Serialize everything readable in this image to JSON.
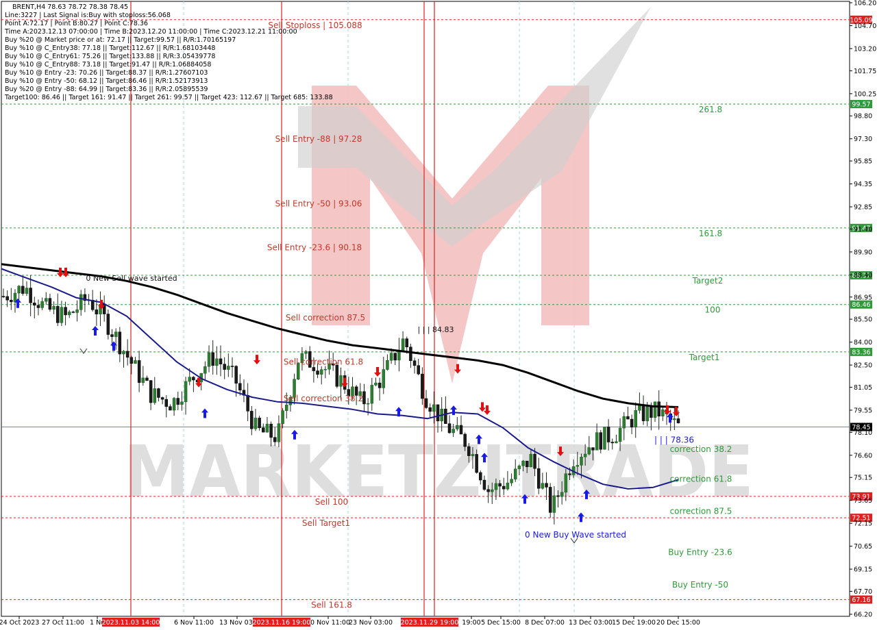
{
  "info_lines": [
    "BRENT,H4  78.63 78.72 78.38 78.45",
    "Line:3227  |  Last Signal is:Buy with stoploss:56.068",
    "Point A:72.17  |  Point B:80.27  |  Point C:78.36",
    "Time A:2023.12.13 07:00:00  |  Time B:2023.12.20 11:00:00  |  Time C:2023.12.21 11:00:00",
    "Buy %20 @ Market price or at: 72.17  ||  Target:99.57  ||  R/R:1.70165197",
    "Buy %10 @ C_Entry38: 77.18  ||  Target:112.67  ||  R/R:1.68103448",
    "Buy %10 @ C_Entry61: 75.26  ||  Target:133.88  ||  R/R:3.05439778",
    "Buy %10 @ C_Entry88: 73.18  ||  Target:91.47  ||  R/R:1.06884058",
    "Buy %10 @ Entry -23: 70.26  ||  Target:88.37  ||  R/R:1.27607103",
    "Buy %10 @ Entry -50: 68.12  ||  Target:86.46  ||  R/R:1.52173913",
    "Buy %20 @ Entry -88: 64.99  ||  Target:83.36  ||  R/R:2.05895539",
    "Target100: 86.46  ||  Target 161: 91.47  ||  Target 261: 99.57  ||  Target 423: 112.67  ||  Target 685: 133.88"
  ],
  "watermark": {
    "text": "MARKETZITRADE",
    "logo_color": "#e05555"
  },
  "chart_data": {
    "type": "line",
    "title": "BRENT,H4",
    "ylim": [
      66.2,
      106.2
    ],
    "y_ticks": [
      "106.20",
      "104.70",
      "103.20",
      "101.75",
      "100.25",
      "98.80",
      "97.30",
      "95.85",
      "94.35",
      "92.85",
      "91.40",
      "89.90",
      "88.40",
      "86.95",
      "85.50",
      "84.00",
      "82.50",
      "81.05",
      "79.55",
      "78.10",
      "76.60",
      "75.15",
      "73.65",
      "72.15",
      "70.65",
      "69.15",
      "67.70",
      "66.20"
    ],
    "x_ticks": [
      "24 Oct 2023",
      "27 Oct 11:00",
      "1 No",
      "6 Nov 11:00",
      "13 Nov 03:",
      "20 Nov 11:00",
      "23 Nov 03:00",
      "19:00",
      "5 Dec 15:00",
      "8 Dec 07:00",
      "13 Dec 03:00",
      "15 Dec 19:00",
      "20 Dec 15:00"
    ],
    "highlighted_times": [
      "2023.11.03 14:00",
      "2023.11.16 19:00",
      "2023.11.29 19:00"
    ],
    "vertical_lines_x_labels": [
      "2023.11.03 14:00",
      "2023.11.16 19:00",
      "2023.11.29 19:00"
    ],
    "current_price": 78.45,
    "levels": [
      {
        "name": "Sell Stoploss",
        "value": 105.09,
        "label": "Sell Stoploss | 105.088",
        "box": "105.09",
        "color": "#e02020",
        "text_color": "red",
        "label_side": "center"
      },
      {
        "name": "261.8",
        "value": 99.57,
        "label": "261.8",
        "box": "99.57",
        "color": "#2e9a3a",
        "text_color": "green",
        "label_side": "right"
      },
      {
        "name": "161.8",
        "value": 91.47,
        "label": "161.8",
        "box": "91.47",
        "color": "#2e9a3a",
        "text_color": "green",
        "label_side": "right"
      },
      {
        "name": "Target2",
        "value": 88.37,
        "label": "Target2",
        "box": "88.37",
        "color": "#2e9a3a",
        "text_color": "green",
        "label_side": "right"
      },
      {
        "name": "100",
        "value": 86.46,
        "label": "100",
        "box": "86.46",
        "color": "#2e9a3a",
        "text_color": "green",
        "label_side": "right"
      },
      {
        "name": "Target1",
        "value": 83.36,
        "label": "Target1",
        "box": "83.36",
        "color": "#2e9a3a",
        "text_color": "green",
        "label_side": "right"
      },
      {
        "name": "Sell 100",
        "value": 73.91,
        "label": "Sell 100",
        "box": "73.91",
        "color": "#e02020",
        "text_color": "red",
        "label_side": "center"
      },
      {
        "name": "Sell Target1",
        "value": 72.51,
        "label": "Sell Target1",
        "box": "72.51",
        "color": "#e02020",
        "text_color": "red",
        "label_side": "center"
      },
      {
        "name": "Sell 161.8",
        "value": 67.16,
        "label": "Sell 161.8",
        "box": "67.16",
        "color": "#e02020",
        "text_color": "red",
        "label_side": "center"
      }
    ],
    "text_labels": [
      {
        "text": "Sell Entry -88 | 97.28",
        "value": 97.28,
        "color": "red"
      },
      {
        "text": "Sell Entry -50 | 93.06",
        "value": 93.06,
        "color": "red"
      },
      {
        "text": "Sell Entry -23.6 | 90.18",
        "value": 90.18,
        "color": "red"
      },
      {
        "text": "Sell correction 87.5",
        "value": 85.6,
        "color": "red"
      },
      {
        "text": "Sell correction 61.8",
        "value": 82.7,
        "color": "red"
      },
      {
        "text": "Sell correction 38.2",
        "value": 80.3,
        "color": "red"
      },
      {
        "text": "correction 38.2",
        "value": 77.0,
        "color": "green"
      },
      {
        "text": "correction 61.8",
        "value": 75.05,
        "color": "green"
      },
      {
        "text": "correction 87.5",
        "value": 72.95,
        "color": "green"
      },
      {
        "text": "Buy Entry -23.6",
        "value": 70.26,
        "color": "green"
      },
      {
        "text": "Buy Entry -50",
        "value": 68.12,
        "color": "green"
      },
      {
        "text": "| | | 84.83",
        "value": 84.83,
        "color": "dark"
      },
      {
        "text": "| | | 78.36",
        "value": 77.6,
        "color": "blue"
      },
      {
        "text": "0 New Sell wave started",
        "value": 88.2,
        "color": "dark"
      },
      {
        "text": "0 New Buy Wave started",
        "value": 71.4,
        "color": "blue"
      }
    ],
    "series": [
      {
        "name": "MA200",
        "color": "#000000",
        "values": [
          89.1,
          88.9,
          88.7,
          88.5,
          88.3,
          88.0,
          87.6,
          87.1,
          86.5,
          85.9,
          85.4,
          84.9,
          84.5,
          84.1,
          83.8,
          83.6,
          83.4,
          83.2,
          83.0,
          82.8,
          82.5,
          82.0,
          81.4,
          80.8,
          80.3,
          80.0,
          79.8,
          79.75
        ]
      },
      {
        "name": "MA50",
        "color": "#1a1a8c",
        "values": [
          88.8,
          88.2,
          87.6,
          86.9,
          86.6,
          85.7,
          84.2,
          82.7,
          81.6,
          80.9,
          80.4,
          80.1,
          80.0,
          79.8,
          79.6,
          79.3,
          79.2,
          79.0,
          79.4,
          79.3,
          78.4,
          77.1,
          76.2,
          75.4,
          74.7,
          74.4,
          74.5,
          75.0
        ]
      },
      {
        "name": "Price",
        "color": "#222222",
        "values": [
          87.0,
          87.6,
          86.2,
          85.6,
          86.9,
          85.1,
          82.8,
          80.6,
          80.0,
          81.7,
          83.1,
          81.5,
          78.2,
          77.8,
          83.0,
          82.5,
          81.5,
          80.0,
          81.8,
          84.2,
          80.5,
          78.5,
          77.4,
          74.3,
          74.9,
          76.4,
          73.0,
          76.4,
          77.5,
          78.0,
          79.2,
          79.5,
          78.45
        ]
      }
    ]
  }
}
